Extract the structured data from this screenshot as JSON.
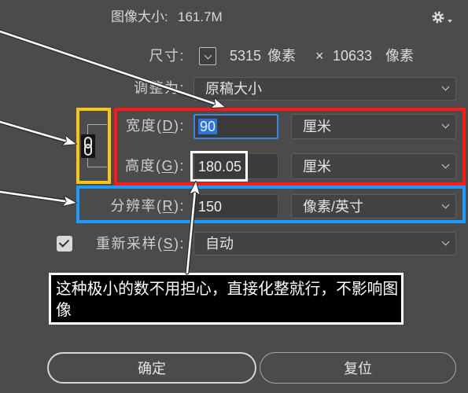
{
  "header": {
    "image_size_label": "图像大小:",
    "image_size_value": "161.7M",
    "settings_icon": "gear-icon",
    "settings_menu_icon": "caret-down-icon"
  },
  "dimensions": {
    "label": "尺寸:",
    "toggle_icon": "chevron-down-icon",
    "width_value": "5315",
    "width_unit": "像素",
    "separator": "×",
    "height_value": "10633",
    "height_unit": "像素"
  },
  "fit_to": {
    "label": "调整为:",
    "selected": "原稿大小"
  },
  "width": {
    "label_pre": "宽度(",
    "access_key": "D",
    "label_post": "):",
    "value": "90",
    "unit": "厘米"
  },
  "constrain": {
    "icon": "link-chain-icon"
  },
  "height": {
    "label_pre": "高度(",
    "access_key": "G",
    "label_post": "):",
    "value": "180.05",
    "unit": "厘米"
  },
  "resolution": {
    "label_pre": "分辨率(",
    "access_key": "R",
    "label_post": "):",
    "value": "150",
    "unit": "像素/英寸"
  },
  "resample": {
    "checked": true,
    "label_pre": "重新采样(",
    "access_key": "S",
    "label_post": "):",
    "selected": "自动"
  },
  "annotation": {
    "note": "这种极小的数不用担心，直接化整就行，不影响图像"
  },
  "buttons": {
    "ok": "确定",
    "reset": "复位"
  },
  "colors": {
    "annotation_red": "#ff1a1a",
    "annotation_yellow": "#f5c518",
    "annotation_blue": "#1e9bff",
    "annotation_white": "#ffffff",
    "focus_blue": "#3b86e0",
    "selection_blue": "#2d74da"
  }
}
